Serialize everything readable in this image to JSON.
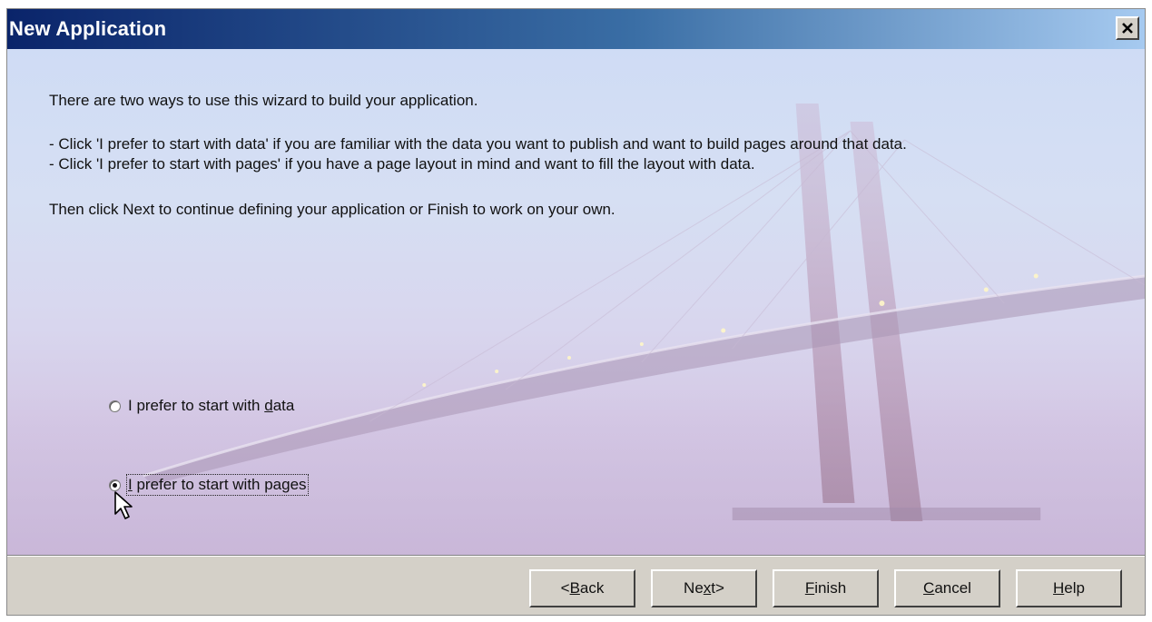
{
  "window": {
    "title": "New Application"
  },
  "intro": {
    "line1": "There are two ways to use this wizard to build your application.",
    "line2": "- Click 'I prefer to start with data' if you are familiar with the data you want to publish and want to build pages around that data.",
    "line3": "- Click 'I prefer to start with pages' if you have a page layout in mind and want to fill the layout with data.",
    "line4": "Then click Next to continue defining your application or Finish to work on your own."
  },
  "options": [
    {
      "pre": "I prefer to start with ",
      "mnemonic": "d",
      "post": "ata",
      "checked": false
    },
    {
      "pre": "",
      "mnemonic": "I",
      "post": " prefer to start with pages",
      "checked": true
    }
  ],
  "buttons": {
    "back": {
      "pre": "<",
      "mnemonic": "B",
      "post": "ack"
    },
    "next": {
      "pre": "Ne",
      "mnemonic": "x",
      "post": "t>"
    },
    "finish": {
      "pre": "",
      "mnemonic": "F",
      "post": "inish"
    },
    "cancel": {
      "pre": "",
      "mnemonic": "C",
      "post": "ancel"
    },
    "help": {
      "pre": "",
      "mnemonic": "H",
      "post": "elp"
    }
  },
  "colors": {
    "titlebar_start": "#0a246a",
    "titlebar_end": "#a6caf0",
    "dialog_face": "#d4d0c8"
  }
}
